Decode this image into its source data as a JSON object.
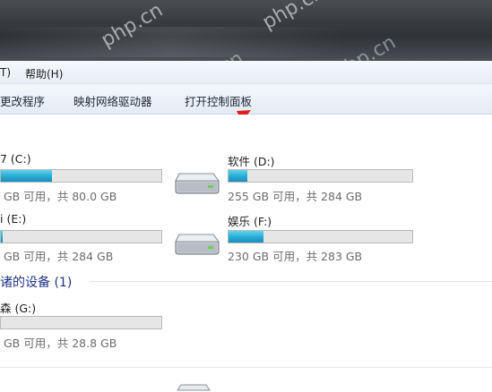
{
  "menubar": {
    "items": [
      {
        "label": "T)"
      },
      {
        "label": "帮助(H)"
      }
    ]
  },
  "toolbar": {
    "items": [
      {
        "label": "更改程序"
      },
      {
        "label": "映射网络驱动器"
      },
      {
        "label": "打开控制面板"
      }
    ]
  },
  "hard_drives": [
    {
      "name": "7 (C:)",
      "info": "GB 可用，共 80.0 GB",
      "used_fraction": 0.32
    },
    {
      "name": "软件 (D:)",
      "info": "255 GB 可用，共 284 GB",
      "used_fraction": 0.1
    },
    {
      "name": "i (E:)",
      "info": "GB 可用，共 284 GB",
      "used_fraction": 0.01
    },
    {
      "name": "娱乐 (F:)",
      "info": "230 GB 可用，共 283 GB",
      "used_fraction": 0.19
    }
  ],
  "removable_group": {
    "heading": "诸的设备 (1)"
  },
  "removable_drives": [
    {
      "name": "森 (G:)",
      "info": "GB 可用，共 28.8 GB",
      "used_fraction": 0.0
    }
  ],
  "annotation": {
    "arrow_color": "#e02020"
  },
  "watermark": {
    "text": "php.cn"
  }
}
